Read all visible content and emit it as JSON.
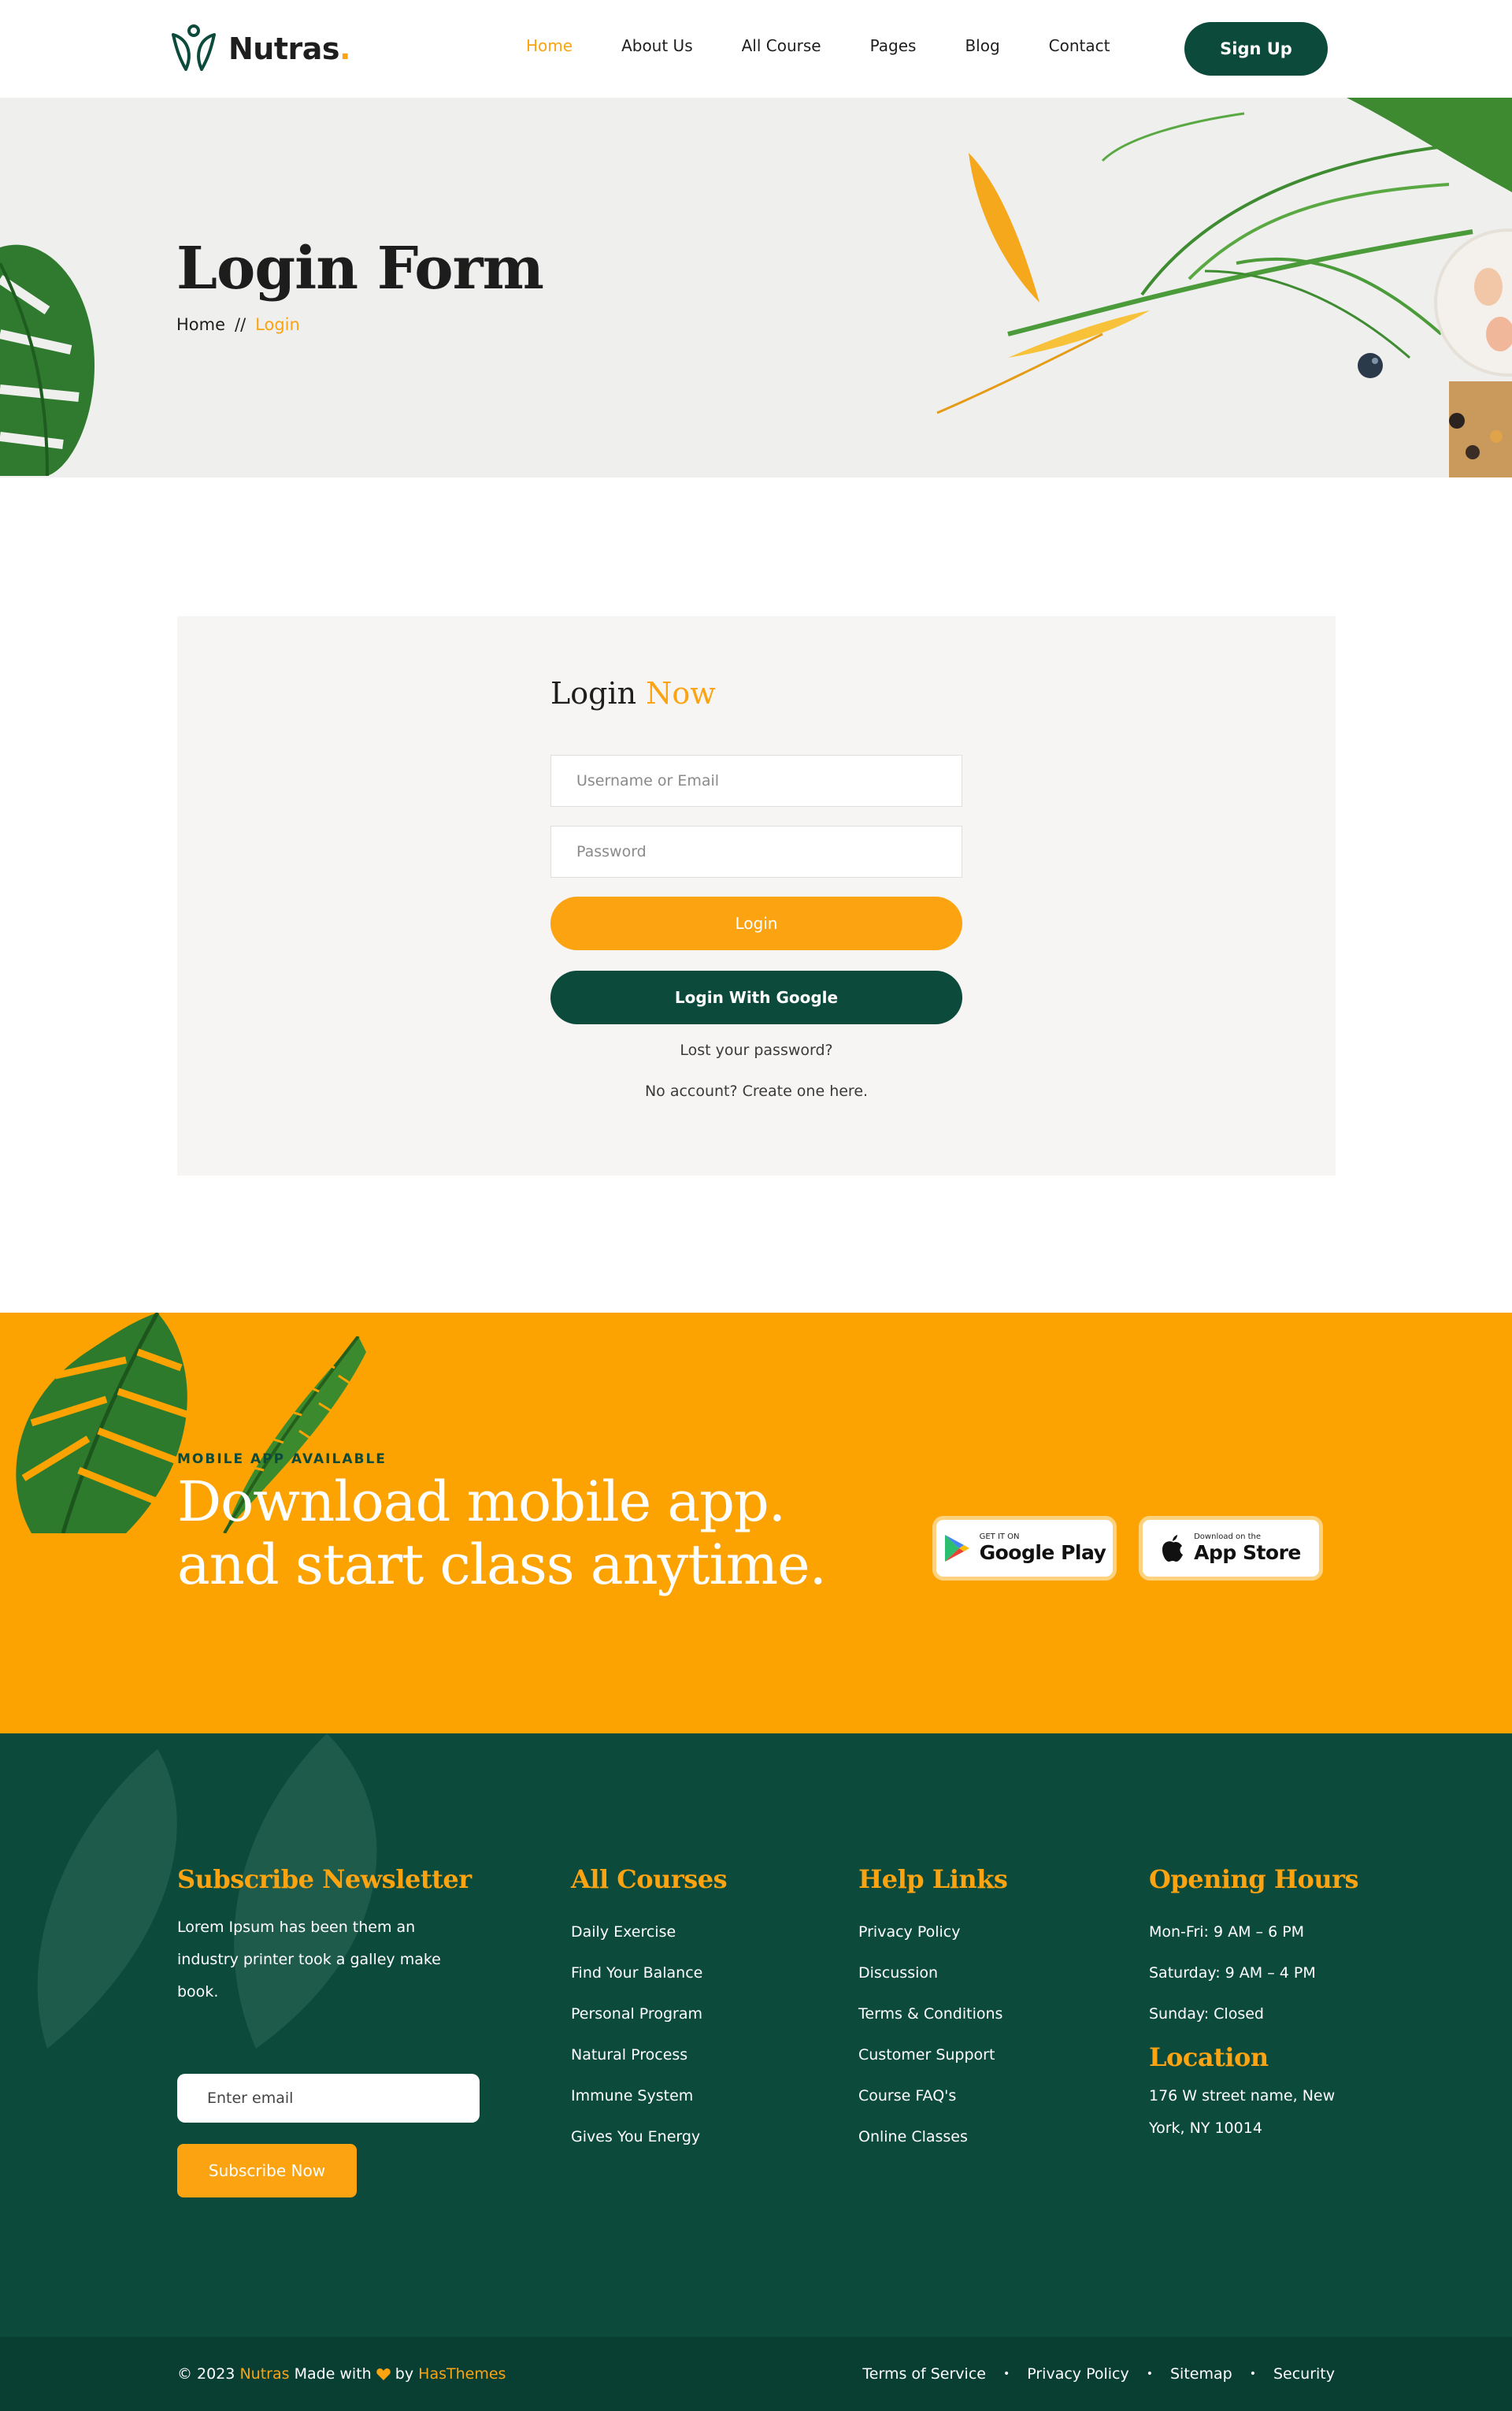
{
  "header": {
    "brand": "Nutras",
    "brand_dot": ".",
    "nav": [
      "Home",
      "About Us",
      "All Course",
      "Pages",
      "Blog",
      "Contact"
    ],
    "signup_label": "Sign Up"
  },
  "hero": {
    "title": "Login Form",
    "breadcrumb_home": "Home",
    "breadcrumb_sep": "//",
    "breadcrumb_current": "Login"
  },
  "login": {
    "heading_main": "Login",
    "heading_accent": "Now",
    "username_placeholder": "Username or Email",
    "password_placeholder": "Password",
    "login_label": "Login",
    "google_label": "Login With Google",
    "lost_password": "Lost your password?",
    "create_account": "No account? Create one here."
  },
  "app": {
    "kicker": "MOBILE APP AVAILABLE",
    "title_line1": "Download mobile app.",
    "title_line2": "and start class anytime.",
    "google_small": "GET IT ON",
    "google_big": "Google Play",
    "apple_small": "Download on the",
    "apple_big": "App Store"
  },
  "footer": {
    "newsletter": {
      "heading": "Subscribe Newsletter",
      "text": "Lorem Ipsum has been them an industry printer took a galley make book.",
      "email_placeholder": "Enter email",
      "button": "Subscribe Now"
    },
    "courses": {
      "heading": "All Courses",
      "items": [
        "Daily Exercise",
        "Find Your Balance",
        "Personal Program",
        "Natural Process",
        "Immune System",
        "Gives You Energy"
      ]
    },
    "help": {
      "heading": "Help Links",
      "items": [
        "Privacy Policy",
        "Discussion",
        "Terms & Conditions",
        "Customer Support",
        "Course FAQ's",
        "Online Classes"
      ]
    },
    "hours": {
      "heading": "Opening Hours",
      "items": [
        "Mon-Fri: 9 AM – 6 PM",
        "Saturday: 9 AM – 4 PM",
        "Sunday: Closed"
      ]
    },
    "location": {
      "heading": "Location",
      "address": "176 W street name, New York, NY 10014"
    }
  },
  "bottom": {
    "copy_prefix": "© 2023",
    "copy_brand": "Nutras",
    "copy_made": "Made with",
    "copy_by": "by",
    "copy_company": "HasThemes",
    "links": [
      "Terms of Service",
      "Privacy Policy",
      "Sitemap",
      "Security"
    ],
    "separator": "•"
  },
  "colors": {
    "accent": "#fca311",
    "dark_green": "#0c4a3c",
    "band": "#fca302"
  }
}
